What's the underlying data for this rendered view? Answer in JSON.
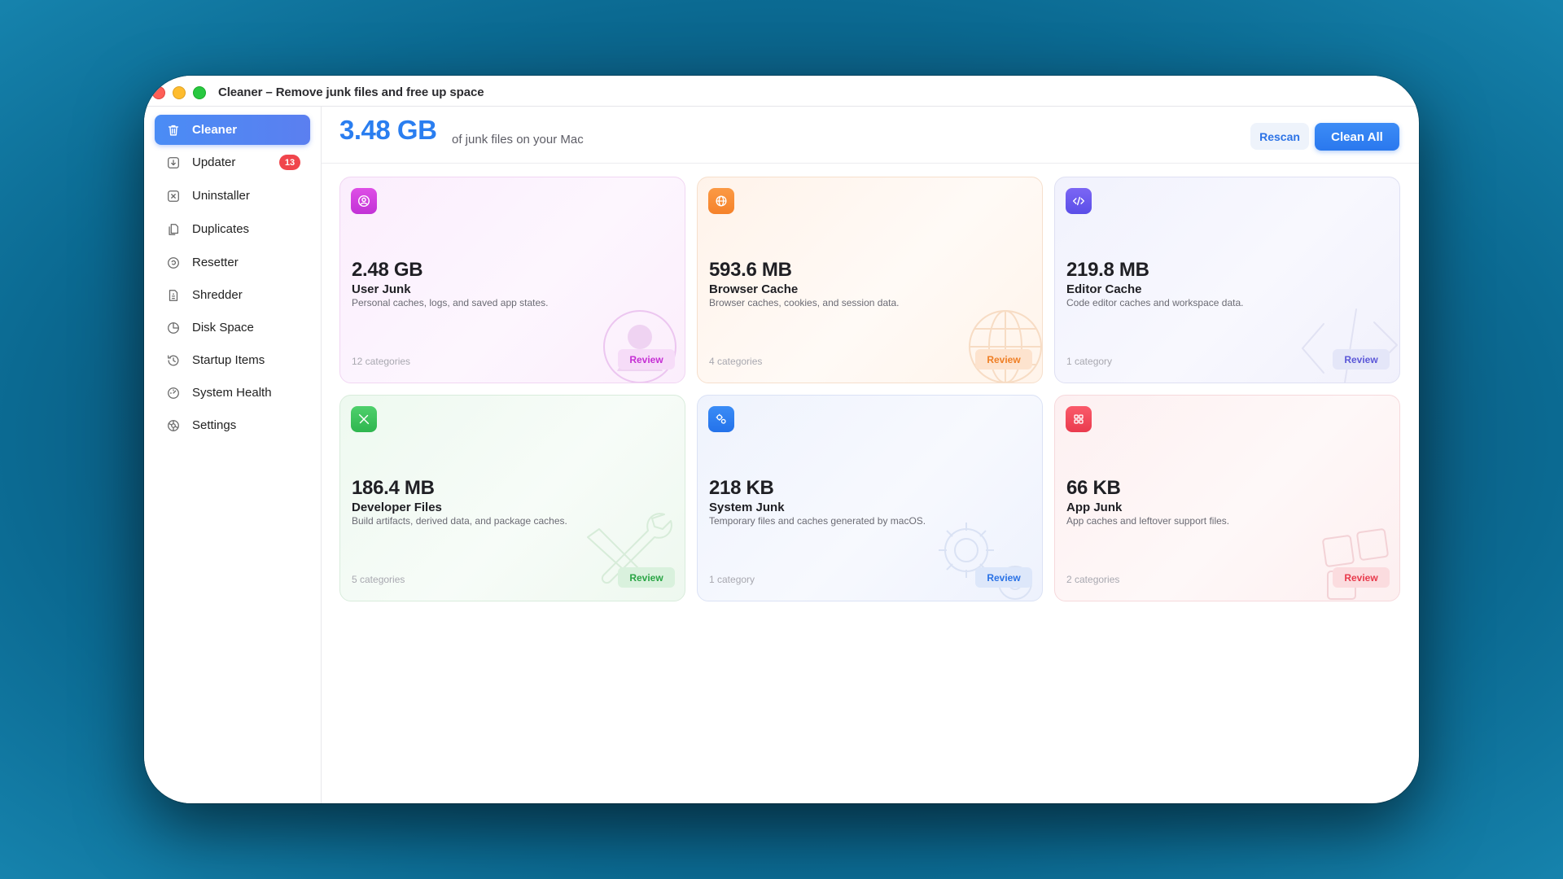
{
  "window": {
    "title": "Cleaner – Remove junk files and free up space"
  },
  "sidebar": {
    "items": [
      {
        "label": "Cleaner",
        "icon": "trash-icon",
        "active": true
      },
      {
        "label": "Updater",
        "icon": "download-icon",
        "badge": "13"
      },
      {
        "label": "Uninstaller",
        "icon": "x-box-icon"
      },
      {
        "label": "Duplicates",
        "icon": "copy-icon"
      },
      {
        "label": "Resetter",
        "icon": "reset-icon"
      },
      {
        "label": "Shredder",
        "icon": "shredder-icon"
      },
      {
        "label": "Disk Space",
        "icon": "pie-chart-icon"
      },
      {
        "label": "Startup Items",
        "icon": "history-icon"
      },
      {
        "label": "System Health",
        "icon": "gauge-icon"
      },
      {
        "label": "Settings",
        "icon": "gear-icon"
      }
    ]
  },
  "header": {
    "total_size": "3.48 GB",
    "total_label": "of junk files on your Mac",
    "rescan_label": "Rescan",
    "clean_all_label": "Clean All"
  },
  "cards": [
    {
      "size": "2.48 GB",
      "title": "User Junk",
      "description": "Personal caches, logs, and saved app states.",
      "count": "12 categories",
      "review_label": "Review",
      "icon": "user-icon",
      "accent": "#d63fe0"
    },
    {
      "size": "593.6 MB",
      "title": "Browser Cache",
      "description": "Browser caches, cookies, and session data.",
      "count": "4 categories",
      "review_label": "Review",
      "icon": "globe-icon",
      "accent": "#f7862e"
    },
    {
      "size": "219.8 MB",
      "title": "Editor Cache",
      "description": "Code editor caches and workspace data.",
      "count": "1 category",
      "review_label": "Review",
      "icon": "code-icon",
      "accent": "#6a5cf0"
    },
    {
      "size": "186.4 MB",
      "title": "Developer Files",
      "description": "Build artifacts, derived data, and package caches.",
      "count": "5 categories",
      "review_label": "Review",
      "icon": "tools-icon",
      "accent": "#34c65a"
    },
    {
      "size": "218 KB",
      "title": "System Junk",
      "description": "Temporary files and caches generated by macOS.",
      "count": "1 category",
      "review_label": "Review",
      "icon": "gears-icon",
      "accent": "#2a7cf0"
    },
    {
      "size": "66 KB",
      "title": "App Junk",
      "description": "App caches and leftover support files.",
      "count": "2 categories",
      "review_label": "Review",
      "icon": "apps-icon",
      "accent": "#f0465a"
    }
  ]
}
